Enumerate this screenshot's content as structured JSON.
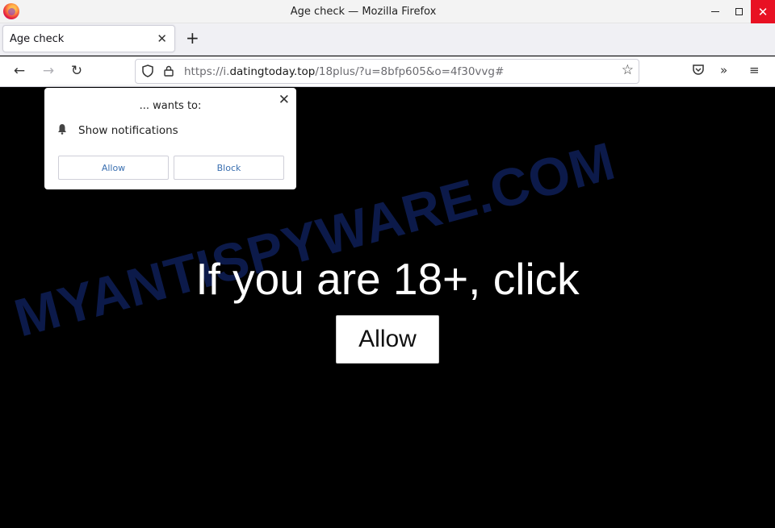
{
  "window": {
    "title": "Age check — Mozilla Firefox",
    "close_glyph": "✕"
  },
  "tab": {
    "label": "Age check",
    "close_glyph": "✕",
    "new_tab_glyph": "+"
  },
  "nav": {
    "back_glyph": "←",
    "forward_glyph": "→",
    "reload_glyph": "↻",
    "url_prefix": "https://i.",
    "url_domain": "datingtoday.top",
    "url_suffix": "/18plus/?u=8bfp605&o=4f30vvg#",
    "star_glyph": "☆",
    "more_glyph": "»",
    "menu_glyph": "≡"
  },
  "popup": {
    "title": "... wants to:",
    "close_glyph": "✕",
    "notification_label": "Show notifications",
    "allow_label": "Allow",
    "block_label": "Block"
  },
  "page": {
    "headline": "If you are 18+, click",
    "allow_label": "Allow"
  },
  "watermark": {
    "text": "MYANTISPYWARE.COM",
    "color": "#0c1a4a"
  },
  "colors": {
    "close_button": "#e81123",
    "link_blue": "#3a6fb0"
  }
}
